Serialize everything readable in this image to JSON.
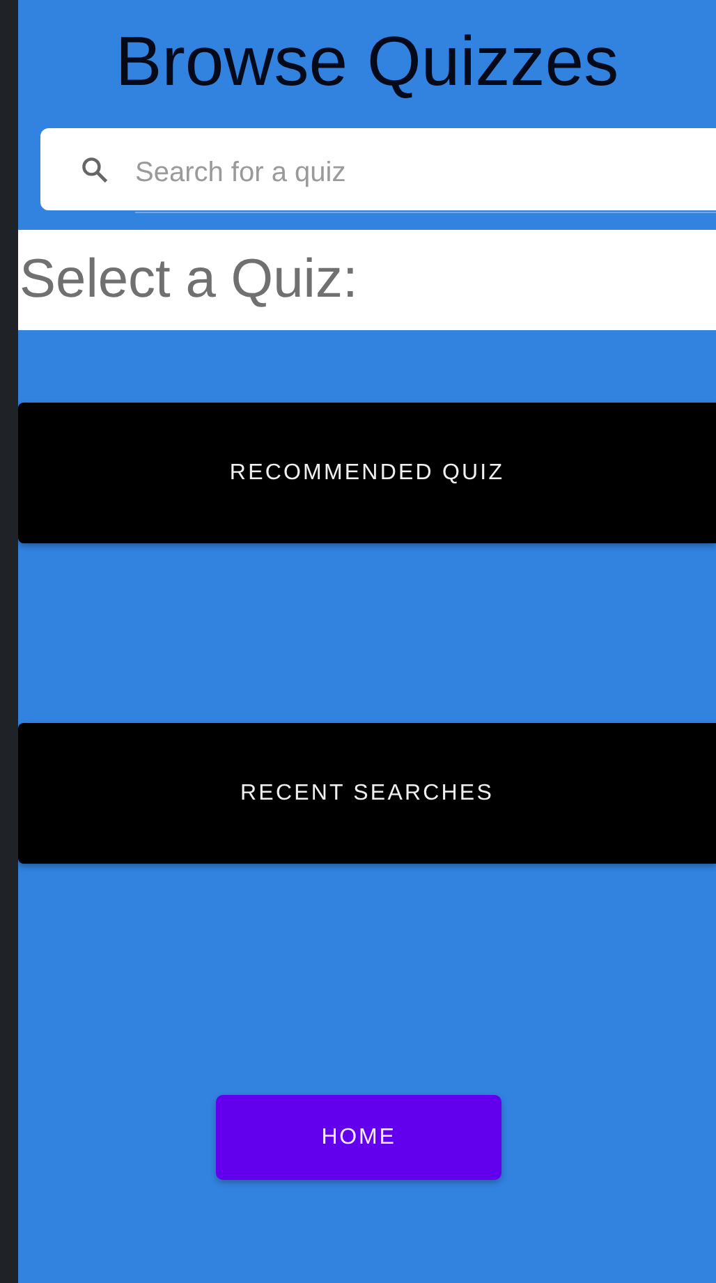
{
  "title": "Browse Quizzes",
  "search": {
    "placeholder": "Search for a quiz"
  },
  "heading": "Select a Quiz:",
  "options": [
    {
      "label": "RECOMMENDED QUIZ"
    },
    {
      "label": "RECENT SEARCHES"
    }
  ],
  "home_button": "HOME"
}
